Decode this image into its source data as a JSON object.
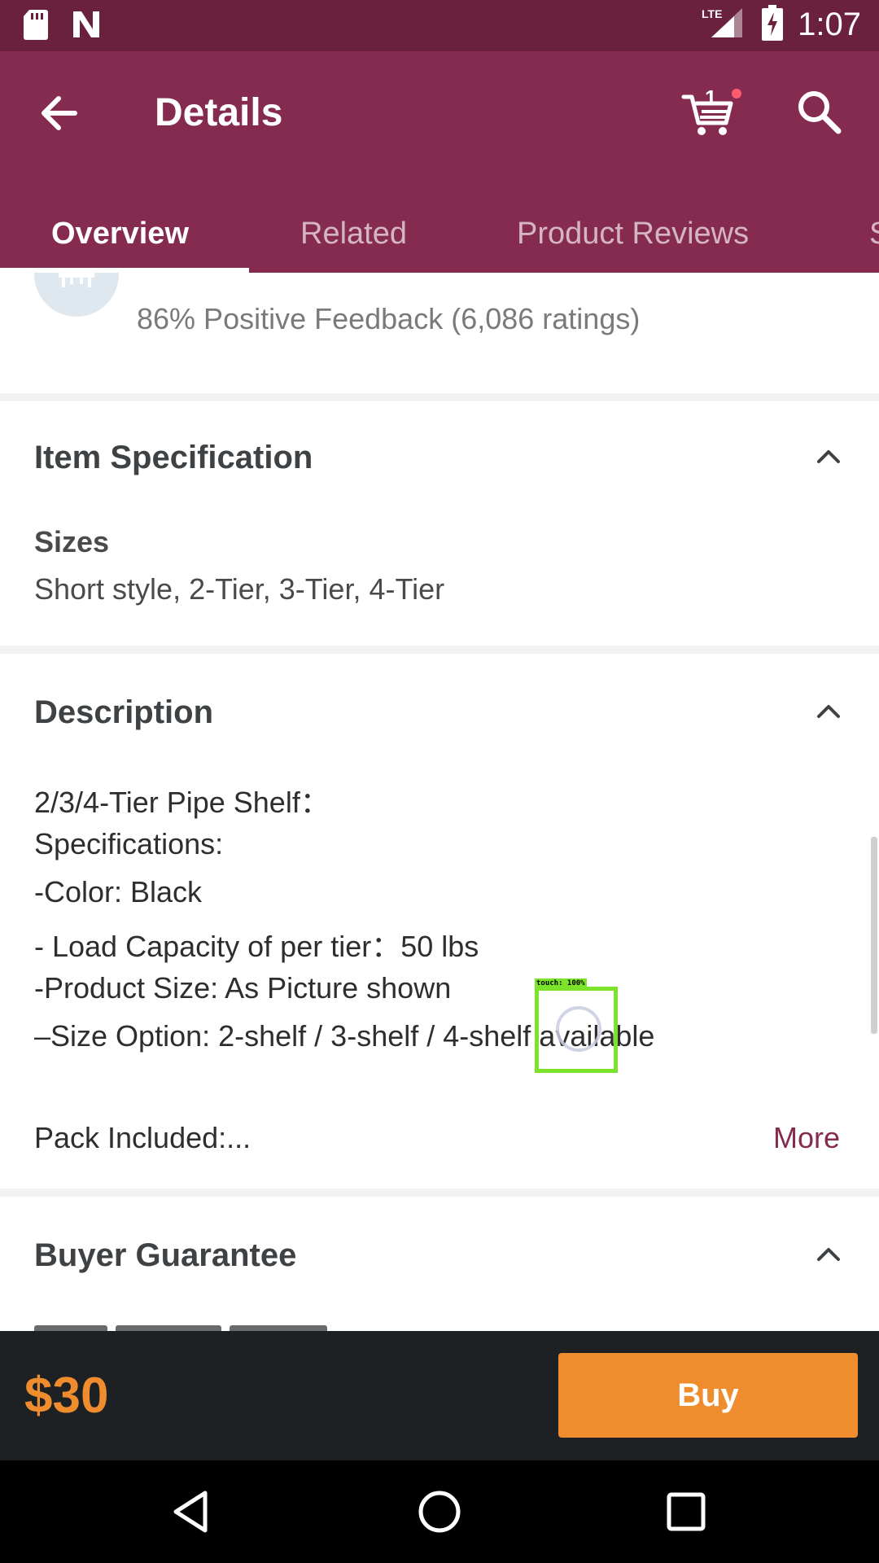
{
  "status_bar": {
    "time": "1:07",
    "network": "LTE",
    "icons": [
      "sd-card-icon",
      "n-notification-icon",
      "signal-icon",
      "battery-charging-icon"
    ]
  },
  "app_bar": {
    "title": "Details",
    "back_icon": "back-arrow-icon",
    "cart_icon": "cart-icon",
    "cart_count": "1",
    "search_icon": "search-icon",
    "colors": {
      "primary": "#852b4f",
      "status": "#6a213e"
    }
  },
  "tabs": [
    {
      "label": "Overview",
      "active": true
    },
    {
      "label": "Related",
      "active": false
    },
    {
      "label": "Product Reviews",
      "active": false
    },
    {
      "label": "S",
      "active": false
    }
  ],
  "seller": {
    "feedback": "86% Positive Feedback (6,086 ratings)"
  },
  "item_specification": {
    "title": "Item Specification",
    "sizes_label": "Sizes",
    "sizes_value": "Short style, 2-Tier, 3-Tier, 4-Tier"
  },
  "description": {
    "title": "Description",
    "lines": [
      "2/3/4-Tier Pipe Shelf：",
      "Specifications:",
      "-Color: Black",
      "- Load Capacity of per tier：50 lbs",
      "-Product Size: As Picture shown",
      "–Size Option: 2-shelf / 3-shelf / 4-shelf  available"
    ],
    "pack_included": "Pack Included:...",
    "more_label": "More"
  },
  "buyer_guarantee": {
    "title": "Buyer Guarantee"
  },
  "touch_indicator": {
    "label": "touch: 100%"
  },
  "purchase": {
    "price": "$30",
    "buy_label": "Buy",
    "accent": "#ef8c2e"
  },
  "nav_bar": {
    "icons": [
      "nav-back-icon",
      "nav-home-icon",
      "nav-recents-icon"
    ]
  }
}
